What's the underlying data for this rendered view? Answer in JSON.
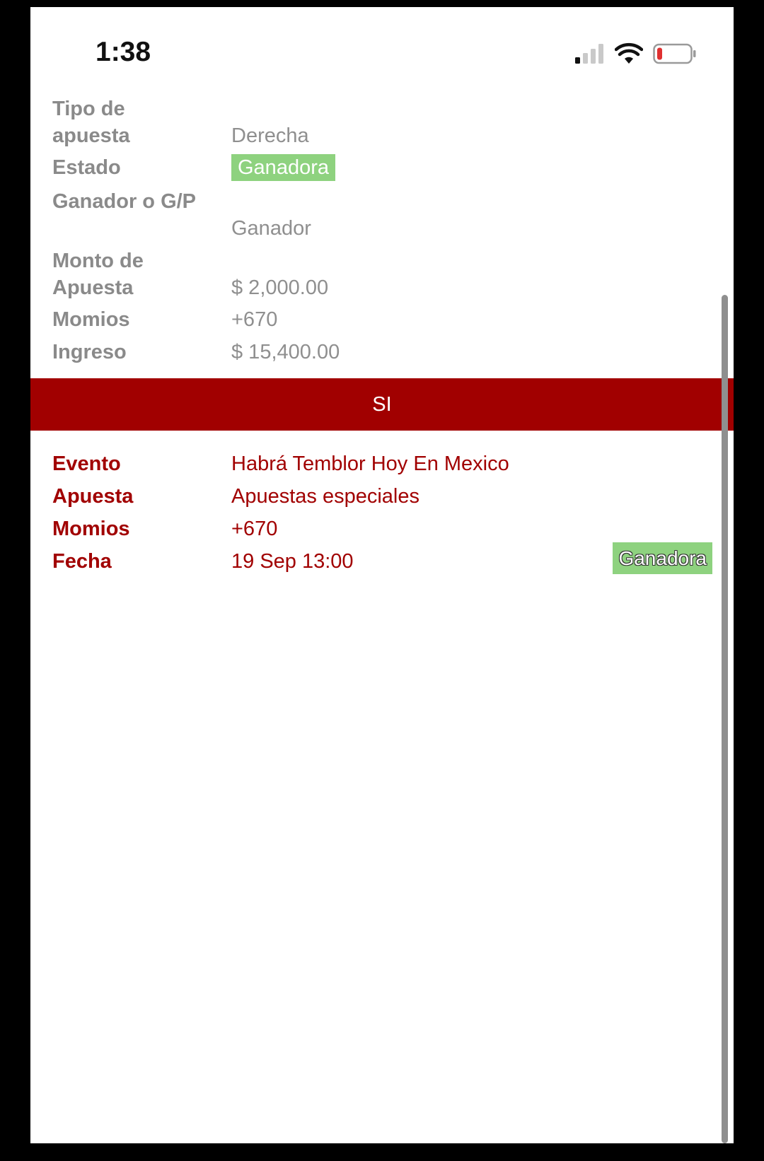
{
  "status_bar": {
    "time": "1:38",
    "icons": [
      "cellular-signal-icon",
      "wifi-icon",
      "battery-low-icon"
    ],
    "battery_color": "#e03030"
  },
  "bet_summary": {
    "rows": [
      {
        "label": "Tipo de apuesta",
        "value": "Derecha"
      },
      {
        "label": "Estado",
        "value": "Ganadora"
      },
      {
        "label": "Ganador o G/P",
        "value": "Ganador"
      },
      {
        "label": "Monto de Apuesta",
        "value": "$ 2,000.00"
      },
      {
        "label": "Momios",
        "value": "+670"
      },
      {
        "label": "Ingreso",
        "value": "$ 15,400.00"
      }
    ]
  },
  "selection_banner": {
    "label": "SI",
    "color": "#a10000"
  },
  "selection_details": {
    "rows": [
      {
        "label": "Evento",
        "value": "Habrá Temblor Hoy En Mexico"
      },
      {
        "label": "Apuesta",
        "value": "Apuestas especiales"
      },
      {
        "label": "Momios",
        "value": "+670"
      },
      {
        "label": "Fecha",
        "value": "19 Sep 13:00"
      }
    ],
    "status_badge": "Ganadora",
    "badge_color": "#8ed27f"
  }
}
